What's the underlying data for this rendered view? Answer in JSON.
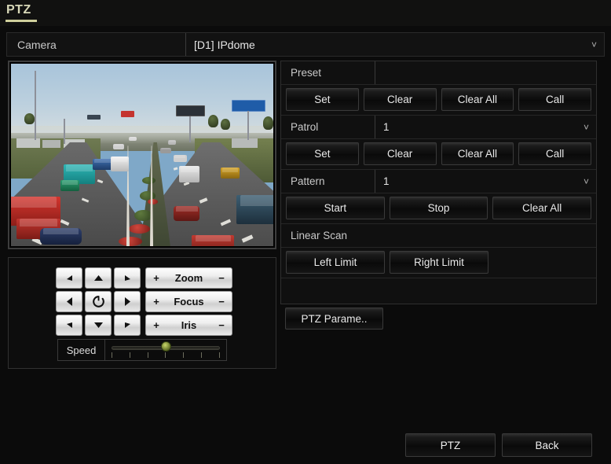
{
  "window": {
    "title": "PTZ"
  },
  "camera": {
    "label": "Camera",
    "value": "[D1] IPdome",
    "chevron": "chevron-down-icon"
  },
  "preview": {
    "scene_description": "highway traffic camera view"
  },
  "pad": {
    "buttons": [
      {
        "name": "pan-up-left",
        "glyph": "arrow-up-left"
      },
      {
        "name": "pan-up",
        "glyph": "arrow-up"
      },
      {
        "name": "pan-up-right",
        "glyph": "arrow-up-right"
      },
      {
        "name": "pan-left",
        "glyph": "arrow-left"
      },
      {
        "name": "auto-scan",
        "glyph": "rotate"
      },
      {
        "name": "pan-right",
        "glyph": "arrow-right"
      },
      {
        "name": "pan-down-left",
        "glyph": "arrow-down-left"
      },
      {
        "name": "pan-down",
        "glyph": "arrow-down"
      },
      {
        "name": "pan-down-right",
        "glyph": "arrow-down-right"
      }
    ],
    "ops": [
      {
        "label": "Zoom",
        "plus": "+",
        "minus": "−"
      },
      {
        "label": "Focus",
        "plus": "+",
        "minus": "−"
      },
      {
        "label": "Iris",
        "plus": "+",
        "minus": "−"
      }
    ],
    "speed": {
      "label": "Speed",
      "ticks": 7,
      "handle_position_percent": 50
    }
  },
  "controls": {
    "preset": {
      "label": "Preset",
      "value": "",
      "buttons": [
        "Set",
        "Clear",
        "Clear All",
        "Call"
      ]
    },
    "patrol": {
      "label": "Patrol",
      "value": "1",
      "chevron": "chevron-down-icon",
      "buttons": [
        "Set",
        "Clear",
        "Clear All",
        "Call"
      ]
    },
    "pattern": {
      "label": "Pattern",
      "value": "1",
      "chevron": "chevron-down-icon",
      "buttons": [
        "Start",
        "Stop",
        "Clear All"
      ]
    },
    "linear_scan": {
      "label": "Linear Scan",
      "buttons": [
        "Left Limit",
        "Right Limit"
      ]
    },
    "ptz_parameter_button": "PTZ Parame.."
  },
  "footer": {
    "ptz_label": "PTZ",
    "back_label": "Back"
  },
  "colors": {
    "title_accent": "#d8d8b8",
    "panel_bg": "#101010",
    "window_bg": "#0b0b0b",
    "key_light": "#eeeeee",
    "slider_handle": "#9fb04a"
  }
}
